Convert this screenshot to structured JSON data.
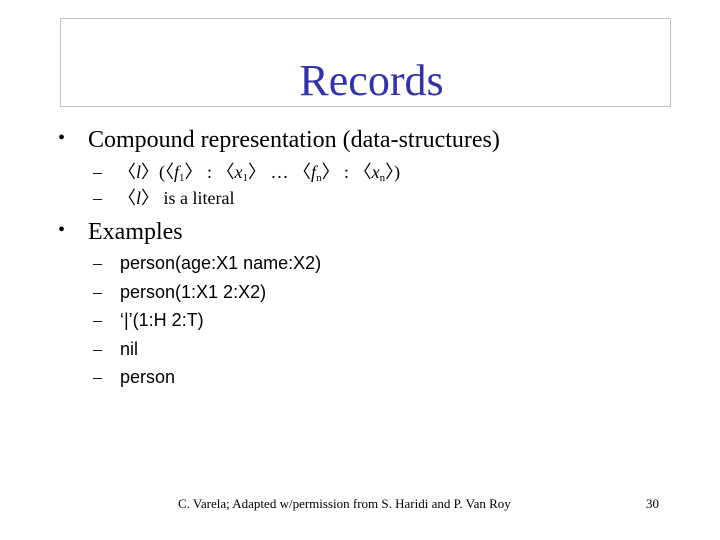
{
  "slide": {
    "title": "Records",
    "bullets": [
      {
        "text": "Compound representation (data-structures)",
        "subitems": [
          {
            "parts": [
              "〈",
              "l",
              "〉(〈",
              "f",
              "1",
              "〉 : 〈",
              "x",
              "1",
              "〉 … 〈",
              "f",
              "n",
              "〉 : 〈",
              "x",
              "n",
              "〉)"
            ]
          },
          {
            "parts": [
              "〈",
              "l",
              "〉 is a literal"
            ]
          }
        ]
      },
      {
        "text": "Examples",
        "subitems": [
          {
            "text": "person(age:X1 name:X2)"
          },
          {
            "text": "person(1:X1 2:X2)"
          },
          {
            "text": "‘|’(1:H 2:T)"
          },
          {
            "text": "nil"
          },
          {
            "text": "person"
          }
        ]
      }
    ],
    "bullet_glyph": "•",
    "dash_glyph": "–",
    "footer": "C. Varela; Adapted w/permission from S. Haridi and P. Van Roy",
    "page_number": "30",
    "title_color": "#3333a9"
  }
}
